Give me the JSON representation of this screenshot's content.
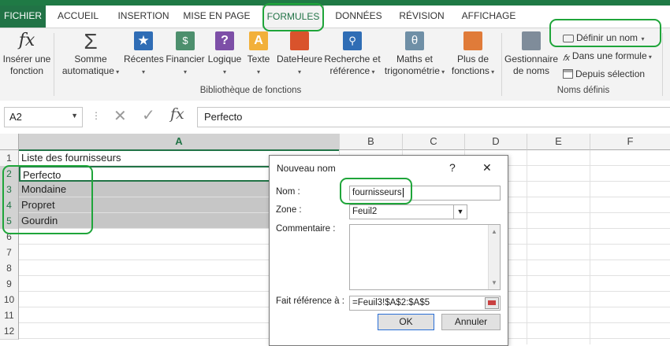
{
  "ribbon_tabs": [
    "FICHIER",
    "ACCUEIL",
    "INSERTION",
    "MISE EN PAGE",
    "FORMULES",
    "DONNÉES",
    "RÉVISION",
    "AFFICHAGE"
  ],
  "active_tab": "FORMULES",
  "ribbon": {
    "insert_function": {
      "line1": "Insérer une",
      "line2": "fonction"
    },
    "autosum": {
      "line1": "Somme",
      "line2": "automatique"
    },
    "recent": "Récentes",
    "financial": "Financier",
    "logical": "Logique",
    "text": "Texte",
    "datetime": "DateHeure",
    "lookup": {
      "line1": "Recherche et",
      "line2": "référence"
    },
    "math": {
      "line1": "Maths et",
      "line2": "trigonométrie"
    },
    "more": {
      "line1": "Plus de",
      "line2": "fonctions"
    },
    "library_group_label": "Bibliothèque de fonctions",
    "name_manager": {
      "line1": "Gestionnaire",
      "line2": "de noms"
    },
    "define_name": "Définir un nom",
    "use_in_formula": "Dans une formule",
    "create_from_selection": "Depuis sélection",
    "names_group_label": "Noms définis"
  },
  "formula_bar": {
    "name_box": "A2",
    "fx": "fx",
    "content": "Perfecto"
  },
  "grid": {
    "columns": [
      "A",
      "B",
      "C",
      "D",
      "E",
      "F"
    ],
    "rows": [
      "1",
      "2",
      "3",
      "4",
      "5",
      "6",
      "7",
      "8",
      "9",
      "10",
      "11",
      "12"
    ],
    "cells": {
      "A1": "Liste des fournisseurs",
      "A2": "Perfecto",
      "A3": "Mondaine",
      "A4": "Propret",
      "A5": "Gourdin"
    }
  },
  "dialog": {
    "title": "Nouveau nom",
    "help": "?",
    "close": "✕",
    "name_label": "Nom :",
    "name_value": "fournisseurs",
    "scope_label": "Zone :",
    "scope_value": "Feuil2",
    "comment_label": "Commentaire :",
    "comment_value": "",
    "refers_label": "Fait référence à :",
    "refers_value": "=Feuil3!$A$2:$A$5",
    "ok": "OK",
    "cancel": "Annuler"
  },
  "colors": {
    "excel_green": "#217346",
    "annotation_green": "#1fa53a",
    "selection_gray": "#c6c6c6"
  }
}
